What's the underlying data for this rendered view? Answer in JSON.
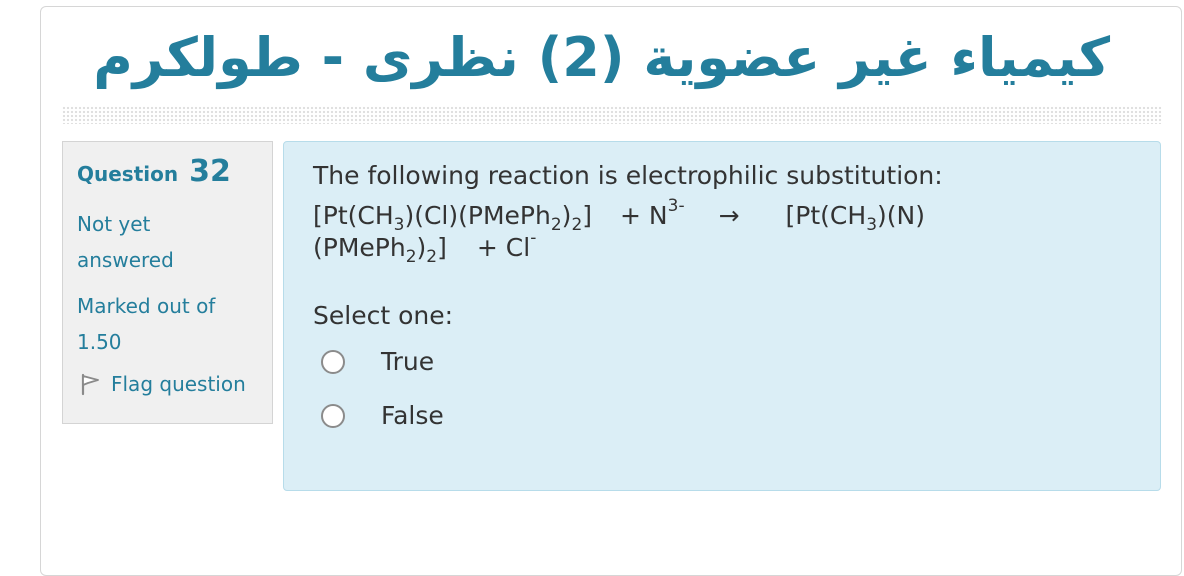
{
  "course": {
    "title": "كيمياء غير عضوية (2) نظرى - طولكرم"
  },
  "question_info": {
    "question_word": "Question",
    "question_number": "32",
    "state": "Not yet answered",
    "grade": "Marked out of 1.50",
    "flag_label": "Flag question",
    "flag_icon": "flag-icon"
  },
  "question": {
    "text": "The following reaction is electrophilic substitution:",
    "reaction": {
      "r1_a": "[Pt(CH",
      "r1_sub1": "3",
      "r1_b": ")(Cl)(PMePh",
      "r1_sub2": "2",
      "r1_c": ")",
      "r1_sub3": "2",
      "r1_d": "]",
      "plus1": "+ N",
      "charge1": "3-",
      "arrow": "→",
      "p1_a": "[Pt(CH",
      "p1_sub1": "3",
      "p1_b": ")(N)",
      "p1_c": "(PMePh",
      "p1_sub2": "2",
      "p1_d": ")",
      "p1_sub3": "2",
      "p1_e": "]",
      "plus2": "+  Cl",
      "charge2": "-"
    },
    "prompt": "Select one:",
    "options": [
      {
        "label": "True",
        "selected": false
      },
      {
        "label": "False",
        "selected": false
      }
    ]
  },
  "colors": {
    "accent": "#247e9c",
    "info_bg": "#f0f0f0",
    "formulation_bg": "#dbeef6",
    "text": "#333333"
  }
}
